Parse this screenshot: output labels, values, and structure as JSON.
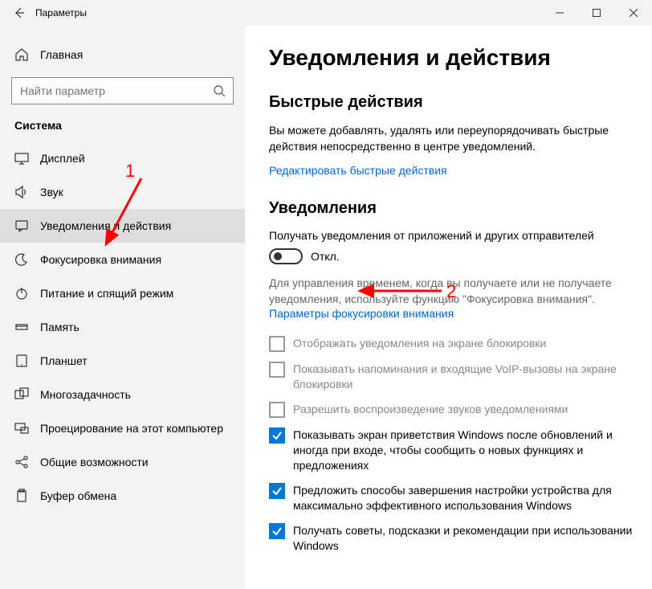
{
  "titlebar": {
    "title": "Параметры"
  },
  "sidebar": {
    "home": "Главная",
    "search_placeholder": "Найти параметр",
    "group": "Система",
    "items": [
      {
        "id": "display",
        "label": "Дисплей",
        "icon": "display",
        "selected": false
      },
      {
        "id": "sound",
        "label": "Звук",
        "icon": "sound",
        "selected": false
      },
      {
        "id": "notifications",
        "label": "Уведомления и действия",
        "icon": "notifications",
        "selected": true
      },
      {
        "id": "focus",
        "label": "Фокусировка внимания",
        "icon": "focus",
        "selected": false
      },
      {
        "id": "power",
        "label": "Питание и спящий режим",
        "icon": "power",
        "selected": false
      },
      {
        "id": "storage",
        "label": "Память",
        "icon": "storage",
        "selected": false
      },
      {
        "id": "tablet",
        "label": "Планшет",
        "icon": "tablet",
        "selected": false
      },
      {
        "id": "multitask",
        "label": "Многозадачность",
        "icon": "multitask",
        "selected": false
      },
      {
        "id": "projecting",
        "label": "Проецирование на этот компьютер",
        "icon": "projecting",
        "selected": false
      },
      {
        "id": "shared",
        "label": "Общие возможности",
        "icon": "shared",
        "selected": false
      },
      {
        "id": "clipboard",
        "label": "Буфер обмена",
        "icon": "clipboard",
        "selected": false
      }
    ]
  },
  "content": {
    "title": "Уведомления и действия",
    "quick": {
      "heading": "Быстрые действия",
      "desc": "Вы можете добавлять, удалять или переупорядочивать быстрые действия непосредственно в центре уведомлений.",
      "link": "Редактировать быстрые действия"
    },
    "notif": {
      "heading": "Уведомления",
      "toggle_label": "Получать уведомления от приложений и других отправителей",
      "toggle_state": "Откл.",
      "hint": "Для управления временем, когда вы получаете или не получаете уведомления, используйте функцию \"Фокусировка внимания\".",
      "focus_link": "Параметры фокусировки внимания"
    },
    "checks": [
      {
        "label": "Отображать уведомления на экране блокировки",
        "enabled": false,
        "checked": false
      },
      {
        "label": "Показывать напоминания и входящие VoIP-вызовы на экране блокировки",
        "enabled": false,
        "checked": false
      },
      {
        "label": "Разрешить  воспроизведение звуков уведомлениями",
        "enabled": false,
        "checked": false
      },
      {
        "label": "Показывать экран приветствия Windows после обновлений и иногда при входе, чтобы сообщить о новых функциях и предложениях",
        "enabled": true,
        "checked": true
      },
      {
        "label": "Предложить способы завершения настройки устройства для максимально эффективного использования Windows",
        "enabled": true,
        "checked": true
      },
      {
        "label": "Получать советы, подсказки и рекомендации при использовании Windows",
        "enabled": true,
        "checked": true
      }
    ]
  },
  "annotations": [
    {
      "num": "1"
    },
    {
      "num": "2"
    }
  ],
  "colors": {
    "accent": "#0078d7",
    "link": "#0066cc",
    "annotation": "#ff0000"
  }
}
